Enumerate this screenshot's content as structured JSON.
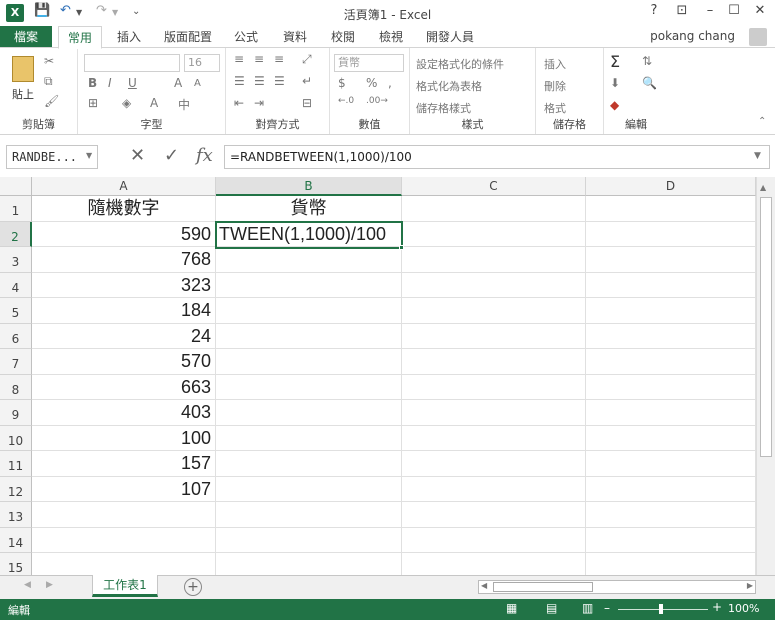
{
  "app": {
    "title": "活頁簿1 - Excel",
    "app_icon": "X"
  },
  "window_controls": [
    "?",
    "⊡",
    "–",
    "☐",
    "✕"
  ],
  "tabs": {
    "file": "檔案",
    "items": [
      "常用",
      "插入",
      "版面配置",
      "公式",
      "資料",
      "校閱",
      "檢視",
      "開發人員"
    ],
    "active": "常用"
  },
  "user": "pokang chang",
  "ribbon": {
    "clipboard": {
      "label": "剪貼簿",
      "paste": "貼上"
    },
    "font": {
      "label": "字型",
      "size": "16",
      "bold": "B",
      "italic": "I",
      "underline": "U"
    },
    "alignment": {
      "label": "對齊方式"
    },
    "number": {
      "label": "數值",
      "format": "貨幣",
      "currency": "$",
      "percent": "%",
      "comma": ","
    },
    "styles": {
      "label": "樣式",
      "items": [
        "設定格式化的條件",
        "格式化為表格",
        "儲存格樣式"
      ]
    },
    "cells": {
      "label": "儲存格",
      "items": [
        "插入",
        "刪除",
        "格式"
      ]
    },
    "editing": {
      "label": "編輯",
      "sum": "Σ"
    }
  },
  "formula_bar": {
    "name_box": "RANDBE...",
    "formula": "=RANDBETWEEN(1,1000)/100"
  },
  "columns": [
    "A",
    "B",
    "C",
    "D"
  ],
  "rows": [
    "1",
    "2",
    "3",
    "4",
    "5",
    "6",
    "7",
    "8",
    "9",
    "10",
    "11",
    "12",
    "13",
    "14",
    "15"
  ],
  "cells": {
    "A1": "隨機數字",
    "B1": "貨幣",
    "B2": "TWEEN(1,1000)/100",
    "A_values": [
      "590",
      "768",
      "323",
      "184",
      "24",
      "570",
      "663",
      "403",
      "100",
      "157",
      "107"
    ]
  },
  "sheet_tabs": {
    "active": "工作表1",
    "add": "+"
  },
  "status": {
    "mode": "編輯",
    "zoom": "100%"
  }
}
